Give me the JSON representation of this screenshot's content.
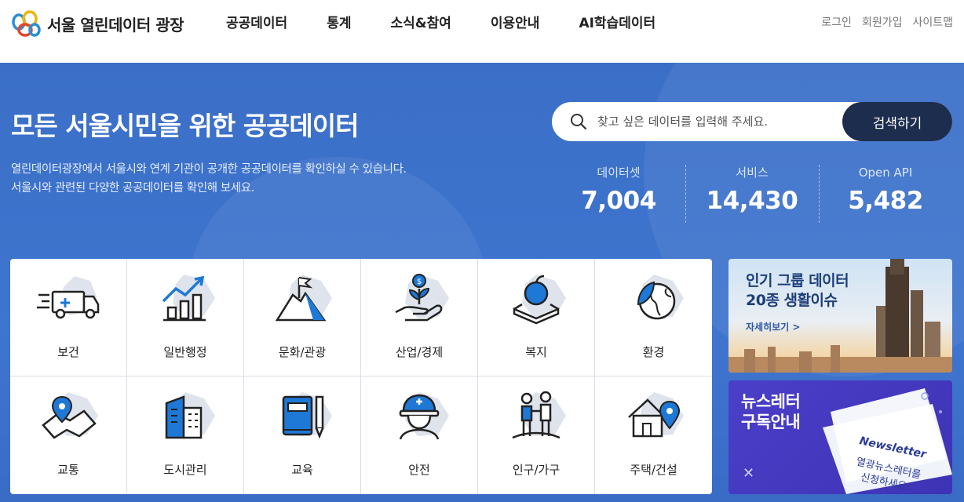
{
  "header": {
    "logo_text": "서울 열린데이터 광장",
    "nav": [
      "공공데이터",
      "통계",
      "소식&참여",
      "이용안내",
      "AI학습데이터"
    ],
    "util": [
      "로그인",
      "회원가입",
      "사이트맵"
    ]
  },
  "hero": {
    "title": "모든 서울시민을 위한 공공데이터",
    "desc_line1": "열린데이터광장에서 서울시와 연계 기관이 공개한 공공데이터를 확인하실 수 있습니다.",
    "desc_line2": "서울시와 관련된 다양한 공공데이터를 확인해 보세요.",
    "search_placeholder": "찾고 싶은 데이터를 입력해 주세요.",
    "search_button": "검색하기",
    "stats": [
      {
        "label": "데이터셋",
        "value": "7,004"
      },
      {
        "label": "서비스",
        "value": "14,430"
      },
      {
        "label": "Open API",
        "value": "5,482"
      }
    ]
  },
  "categories": [
    {
      "label": "보건",
      "icon": "ambulance-icon"
    },
    {
      "label": "일반행정",
      "icon": "growth-chart-icon"
    },
    {
      "label": "문화/관광",
      "icon": "mountain-flag-icon"
    },
    {
      "label": "산업/경제",
      "icon": "money-plant-icon"
    },
    {
      "label": "복지",
      "icon": "apple-book-icon"
    },
    {
      "label": "환경",
      "icon": "earth-leaf-icon"
    },
    {
      "label": "교통",
      "icon": "map-pin-icon"
    },
    {
      "label": "도시관리",
      "icon": "buildings-icon"
    },
    {
      "label": "교육",
      "icon": "book-pencil-icon"
    },
    {
      "label": "안전",
      "icon": "helmet-worker-icon"
    },
    {
      "label": "인구/가구",
      "icon": "family-icon"
    },
    {
      "label": "주택/건설",
      "icon": "house-pin-icon"
    }
  ],
  "banners": {
    "popular_title_1": "인기 그룹 데이터",
    "popular_title_2": "20종 생활이슈",
    "popular_link": "자세히보기 >",
    "newsletter_title_1": "뉴스레터",
    "newsletter_title_2": "구독안내",
    "newsletter_badge": "Newsletter",
    "newsletter_sub_1": "열광뉴스레터를",
    "newsletter_sub_2": "신청하세요!",
    "newsletter_close": "✕"
  },
  "colors": {
    "hero_bg": "#3f75cf",
    "search_btn": "#1d2d4d",
    "banner2_bg": "#4b3fc9"
  }
}
